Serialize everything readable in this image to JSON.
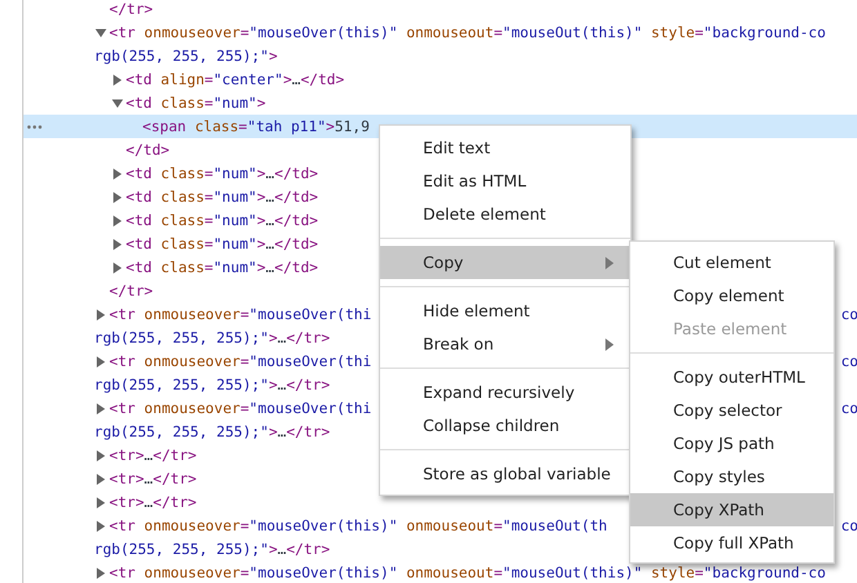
{
  "tree": [
    {
      "selected": false,
      "lines": [
        {
          "tokens": [
            {
              "kind": "tag",
              "text": "</tr>"
            }
          ]
        }
      ]
    },
    {
      "selected": false,
      "expanded": true,
      "lines": [
        {
          "tokens": [
            {
              "kind": "tag",
              "text": "<tr "
            },
            {
              "kind": "attr",
              "text": "onmouseover"
            },
            {
              "kind": "tag",
              "text": "="
            },
            {
              "kind": "value",
              "text": "\"mouseOver(this)\" "
            },
            {
              "kind": "attr",
              "text": "onmouseout"
            },
            {
              "kind": "tag",
              "text": "="
            },
            {
              "kind": "value",
              "text": "\"mouseOut(this)\" "
            },
            {
              "kind": "attr",
              "text": "style"
            },
            {
              "kind": "tag",
              "text": "="
            },
            {
              "kind": "value",
              "text": "\"background-co"
            }
          ]
        },
        {
          "tokens": [
            {
              "kind": "value",
              "text": "rgb(255, 255, 255);\""
            },
            {
              "kind": "tag",
              "text": ">"
            }
          ]
        }
      ],
      "children": [
        {
          "selected": false,
          "expanded": false,
          "lines": [
            {
              "tokens": [
                {
                  "kind": "tag",
                  "text": "<td "
                },
                {
                  "kind": "attr",
                  "text": "align"
                },
                {
                  "kind": "tag",
                  "text": "="
                },
                {
                  "kind": "value",
                  "text": "\"center\""
                },
                {
                  "kind": "tag",
                  "text": ">"
                },
                {
                  "kind": "text",
                  "text": "…"
                },
                {
                  "kind": "tag",
                  "text": "</td>"
                }
              ]
            }
          ]
        },
        {
          "selected": false,
          "expanded": true,
          "lines": [
            {
              "tokens": [
                {
                  "kind": "tag",
                  "text": "<td "
                },
                {
                  "kind": "attr",
                  "text": "class"
                },
                {
                  "kind": "tag",
                  "text": "="
                },
                {
                  "kind": "value",
                  "text": "\"num\""
                },
                {
                  "kind": "tag",
                  "text": ">"
                }
              ]
            }
          ],
          "children": [
            {
              "selected": true,
              "lines": [
                {
                  "tokens": [
                    {
                      "kind": "tag",
                      "text": "<span "
                    },
                    {
                      "kind": "attr",
                      "text": "class"
                    },
                    {
                      "kind": "tag",
                      "text": "="
                    },
                    {
                      "kind": "value",
                      "text": "\"tah p11\""
                    },
                    {
                      "kind": "tag",
                      "text": ">"
                    },
                    {
                      "kind": "text",
                      "text": "51,9"
                    }
                  ]
                }
              ]
            }
          ],
          "close": [
            {
              "kind": "tag",
              "text": "</td>"
            }
          ]
        },
        {
          "selected": false,
          "expanded": false,
          "lines": [
            {
              "tokens": [
                {
                  "kind": "tag",
                  "text": "<td "
                },
                {
                  "kind": "attr",
                  "text": "class"
                },
                {
                  "kind": "tag",
                  "text": "="
                },
                {
                  "kind": "value",
                  "text": "\"num\""
                },
                {
                  "kind": "tag",
                  "text": ">"
                },
                {
                  "kind": "text",
                  "text": "…"
                },
                {
                  "kind": "tag",
                  "text": "</td>"
                }
              ]
            }
          ]
        },
        {
          "selected": false,
          "expanded": false,
          "lines": [
            {
              "tokens": [
                {
                  "kind": "tag",
                  "text": "<td "
                },
                {
                  "kind": "attr",
                  "text": "class"
                },
                {
                  "kind": "tag",
                  "text": "="
                },
                {
                  "kind": "value",
                  "text": "\"num\""
                },
                {
                  "kind": "tag",
                  "text": ">"
                },
                {
                  "kind": "text",
                  "text": "…"
                },
                {
                  "kind": "tag",
                  "text": "</td>"
                }
              ]
            }
          ]
        },
        {
          "selected": false,
          "expanded": false,
          "lines": [
            {
              "tokens": [
                {
                  "kind": "tag",
                  "text": "<td "
                },
                {
                  "kind": "attr",
                  "text": "class"
                },
                {
                  "kind": "tag",
                  "text": "="
                },
                {
                  "kind": "value",
                  "text": "\"num\""
                },
                {
                  "kind": "tag",
                  "text": ">"
                },
                {
                  "kind": "text",
                  "text": "…"
                },
                {
                  "kind": "tag",
                  "text": "</td>"
                }
              ]
            }
          ]
        },
        {
          "selected": false,
          "expanded": false,
          "lines": [
            {
              "tokens": [
                {
                  "kind": "tag",
                  "text": "<td "
                },
                {
                  "kind": "attr",
                  "text": "class"
                },
                {
                  "kind": "tag",
                  "text": "="
                },
                {
                  "kind": "value",
                  "text": "\"num\""
                },
                {
                  "kind": "tag",
                  "text": ">"
                },
                {
                  "kind": "text",
                  "text": "…"
                },
                {
                  "kind": "tag",
                  "text": "</td>"
                }
              ]
            }
          ]
        },
        {
          "selected": false,
          "expanded": false,
          "lines": [
            {
              "tokens": [
                {
                  "kind": "tag",
                  "text": "<td "
                },
                {
                  "kind": "attr",
                  "text": "class"
                },
                {
                  "kind": "tag",
                  "text": "="
                },
                {
                  "kind": "value",
                  "text": "\"num\""
                },
                {
                  "kind": "tag",
                  "text": ">"
                },
                {
                  "kind": "text",
                  "text": "…"
                },
                {
                  "kind": "tag",
                  "text": "</td>"
                }
              ]
            }
          ]
        }
      ],
      "close": [
        {
          "kind": "tag",
          "text": "</tr>"
        }
      ]
    },
    {
      "selected": false,
      "expanded": false,
      "lines": [
        {
          "tail": "co",
          "tokens": [
            {
              "kind": "tag",
              "text": "<tr "
            },
            {
              "kind": "attr",
              "text": "onmouseover"
            },
            {
              "kind": "tag",
              "text": "="
            },
            {
              "kind": "value",
              "text": "\"mouseOver(thi"
            }
          ]
        },
        {
          "tokens": [
            {
              "kind": "value",
              "text": "rgb(255, 255, 255);\""
            },
            {
              "kind": "tag",
              "text": ">"
            },
            {
              "kind": "text",
              "text": "…"
            },
            {
              "kind": "tag",
              "text": "</tr>"
            }
          ]
        }
      ]
    },
    {
      "selected": false,
      "expanded": false,
      "lines": [
        {
          "tail": "co",
          "tokens": [
            {
              "kind": "tag",
              "text": "<tr "
            },
            {
              "kind": "attr",
              "text": "onmouseover"
            },
            {
              "kind": "tag",
              "text": "="
            },
            {
              "kind": "value",
              "text": "\"mouseOver(thi"
            }
          ]
        },
        {
          "tokens": [
            {
              "kind": "value",
              "text": "rgb(255, 255, 255);\""
            },
            {
              "kind": "tag",
              "text": ">"
            },
            {
              "kind": "text",
              "text": "…"
            },
            {
              "kind": "tag",
              "text": "</tr>"
            }
          ]
        }
      ]
    },
    {
      "selected": false,
      "expanded": false,
      "lines": [
        {
          "tail": "co",
          "tokens": [
            {
              "kind": "tag",
              "text": "<tr "
            },
            {
              "kind": "attr",
              "text": "onmouseover"
            },
            {
              "kind": "tag",
              "text": "="
            },
            {
              "kind": "value",
              "text": "\"mouseOver(thi"
            }
          ]
        },
        {
          "tokens": [
            {
              "kind": "value",
              "text": "rgb(255, 255, 255);\""
            },
            {
              "kind": "tag",
              "text": ">"
            },
            {
              "kind": "text",
              "text": "…"
            },
            {
              "kind": "tag",
              "text": "</tr>"
            }
          ]
        }
      ]
    },
    {
      "selected": false,
      "expanded": false,
      "lines": [
        {
          "tokens": [
            {
              "kind": "tag",
              "text": "<tr>"
            },
            {
              "kind": "text",
              "text": "…"
            },
            {
              "kind": "tag",
              "text": "</tr>"
            }
          ]
        }
      ]
    },
    {
      "selected": false,
      "expanded": false,
      "lines": [
        {
          "tokens": [
            {
              "kind": "tag",
              "text": "<tr>"
            },
            {
              "kind": "text",
              "text": "…"
            },
            {
              "kind": "tag",
              "text": "</tr>"
            }
          ]
        }
      ]
    },
    {
      "selected": false,
      "expanded": false,
      "lines": [
        {
          "tokens": [
            {
              "kind": "tag",
              "text": "<tr>"
            },
            {
              "kind": "text",
              "text": "…"
            },
            {
              "kind": "tag",
              "text": "</tr>"
            }
          ]
        }
      ]
    },
    {
      "selected": false,
      "expanded": false,
      "lines": [
        {
          "tail": "co",
          "tokens": [
            {
              "kind": "tag",
              "text": "<tr "
            },
            {
              "kind": "attr",
              "text": "onmouseover"
            },
            {
              "kind": "tag",
              "text": "="
            },
            {
              "kind": "value",
              "text": "\"mouseOver(this)\" "
            },
            {
              "kind": "attr",
              "text": "onmouseout"
            },
            {
              "kind": "tag",
              "text": "="
            },
            {
              "kind": "value",
              "text": "\"mouseOut(th"
            }
          ]
        },
        {
          "tokens": [
            {
              "kind": "value",
              "text": "rgb(255, 255, 255);\""
            },
            {
              "kind": "tag",
              "text": ">"
            },
            {
              "kind": "text",
              "text": "…"
            },
            {
              "kind": "tag",
              "text": "</tr>"
            }
          ]
        }
      ]
    },
    {
      "selected": false,
      "expanded": false,
      "lines": [
        {
          "tokens": [
            {
              "kind": "tag",
              "text": "<tr "
            },
            {
              "kind": "attr",
              "text": "onmouseover"
            },
            {
              "kind": "tag",
              "text": "="
            },
            {
              "kind": "value",
              "text": "\"mouseOver(this)\" "
            },
            {
              "kind": "attr",
              "text": "onmouseout"
            },
            {
              "kind": "tag",
              "text": "="
            },
            {
              "kind": "value",
              "text": "\"mouseOut(this)\" "
            },
            {
              "kind": "attr",
              "text": "style"
            },
            {
              "kind": "tag",
              "text": "="
            },
            {
              "kind": "value",
              "text": "\"background-co"
            }
          ]
        }
      ]
    }
  ],
  "context_menu": {
    "items": [
      {
        "kind": "item",
        "label": "Edit text",
        "selected": false,
        "disabled": false,
        "submenu": false
      },
      {
        "kind": "item",
        "label": "Edit as HTML",
        "selected": false,
        "disabled": false,
        "submenu": false
      },
      {
        "kind": "item",
        "label": "Delete element",
        "selected": false,
        "disabled": false,
        "submenu": false
      },
      {
        "kind": "separator"
      },
      {
        "kind": "item",
        "label": "Copy",
        "selected": true,
        "disabled": false,
        "submenu": true
      },
      {
        "kind": "separator"
      },
      {
        "kind": "item",
        "label": "Hide element",
        "selected": false,
        "disabled": false,
        "submenu": false
      },
      {
        "kind": "item",
        "label": "Break on",
        "selected": false,
        "disabled": false,
        "submenu": true
      },
      {
        "kind": "separator"
      },
      {
        "kind": "item",
        "label": "Expand recursively",
        "selected": false,
        "disabled": false,
        "submenu": false
      },
      {
        "kind": "item",
        "label": "Collapse children",
        "selected": false,
        "disabled": false,
        "submenu": false
      },
      {
        "kind": "separator"
      },
      {
        "kind": "item",
        "label": "Store as global variable",
        "selected": false,
        "disabled": false,
        "submenu": false
      }
    ]
  },
  "copy_submenu": {
    "items": [
      {
        "kind": "item",
        "label": "Cut element",
        "selected": false,
        "disabled": false,
        "submenu": false
      },
      {
        "kind": "item",
        "label": "Copy element",
        "selected": false,
        "disabled": false,
        "submenu": false
      },
      {
        "kind": "item",
        "label": "Paste element",
        "selected": false,
        "disabled": true,
        "submenu": false
      },
      {
        "kind": "separator"
      },
      {
        "kind": "item",
        "label": "Copy outerHTML",
        "selected": false,
        "disabled": false,
        "submenu": false
      },
      {
        "kind": "item",
        "label": "Copy selector",
        "selected": false,
        "disabled": false,
        "submenu": false
      },
      {
        "kind": "item",
        "label": "Copy JS path",
        "selected": false,
        "disabled": false,
        "submenu": false
      },
      {
        "kind": "item",
        "label": "Copy styles",
        "selected": false,
        "disabled": false,
        "submenu": false
      },
      {
        "kind": "item",
        "label": "Copy XPath",
        "selected": true,
        "disabled": false,
        "submenu": false
      },
      {
        "kind": "item",
        "label": "Copy full XPath",
        "selected": false,
        "disabled": false,
        "submenu": false
      }
    ]
  }
}
